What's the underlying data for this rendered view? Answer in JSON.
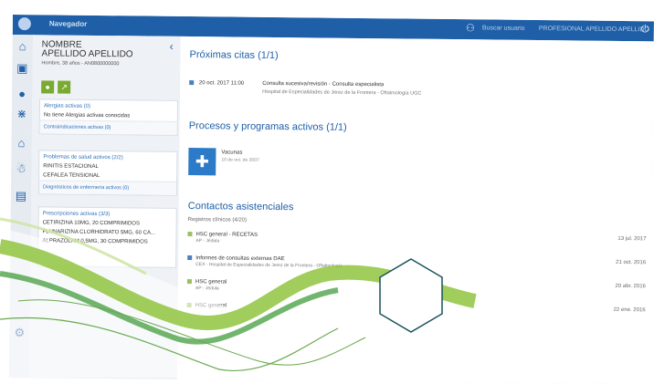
{
  "topbar": {
    "nav_label": "Navegador",
    "search_label": "Buscar usuario",
    "user_name": "PROFESIONAL APELLIDO APELLIDO"
  },
  "patient": {
    "name_line1": "NOMBRE",
    "name_line2": "APELLIDO APELLIDO",
    "info": "Hombre, 38 años - AN0800000000"
  },
  "allergies": {
    "header": "Alergias activas (0)",
    "text": "No tiene Alergias activas conocidas",
    "footer": "Contraindicaciones activas (0)"
  },
  "problems": {
    "header": "Problemas de salud activos (2/2)",
    "items": [
      "RINITIS ESTACIONAL",
      "CEFALEA TENSIONAL"
    ],
    "footer": "Diagnósticos de enfermería activos (0)"
  },
  "prescriptions": {
    "header": "Prescripciones activas (3/3)",
    "items": [
      "CETIRIZINA 10MG, 20 COMPRIMIDOS",
      "FLUNARIZINA CLORHIDRATO 5MG, 60 CA...",
      "ALPRAZOLAM 0,5MG, 30 COMPRIMIDOS"
    ]
  },
  "citas": {
    "title": "Próximas citas (1/1)",
    "date": "20 oct. 2017 11:00",
    "desc": "Consulta sucesiva/revisión - Consulta especialista",
    "place": "Hospital de Especialidades de Jerez de la Frontera - Oftalmología UGC"
  },
  "procesos": {
    "title": "Procesos y programas activos (1/1)",
    "item_title": "Vacunas",
    "item_date": "10 de oct. de 2007"
  },
  "contactos": {
    "title": "Contactos asistenciales",
    "subtitle": "Registros clínicos (4/20)",
    "rows": [
      {
        "title": "HSC general - RECETAS",
        "sub": "AP - Jédula",
        "date": "13 jul. 2017"
      },
      {
        "title": "Informes de consultas externas DAE",
        "sub": "CEX - Hospital de Especialidades de Jerez de la Frontera - Oftalmología",
        "date": "21 oct. 2016"
      },
      {
        "title": "HSC general",
        "sub": "AP - Jédula",
        "date": "20 abr. 2016"
      },
      {
        "title": "HSC general",
        "sub": "",
        "date": "22 ene. 2016"
      }
    ]
  },
  "colors": {
    "primary": "#1e5fa8",
    "green": "#7aaa2f",
    "wave": "#8fc43e"
  },
  "icons": [
    "home-icon",
    "calendar-icon",
    "person-icon",
    "family-icon",
    "house-icon",
    "people-icon",
    "document-icon",
    "power-icon"
  ]
}
